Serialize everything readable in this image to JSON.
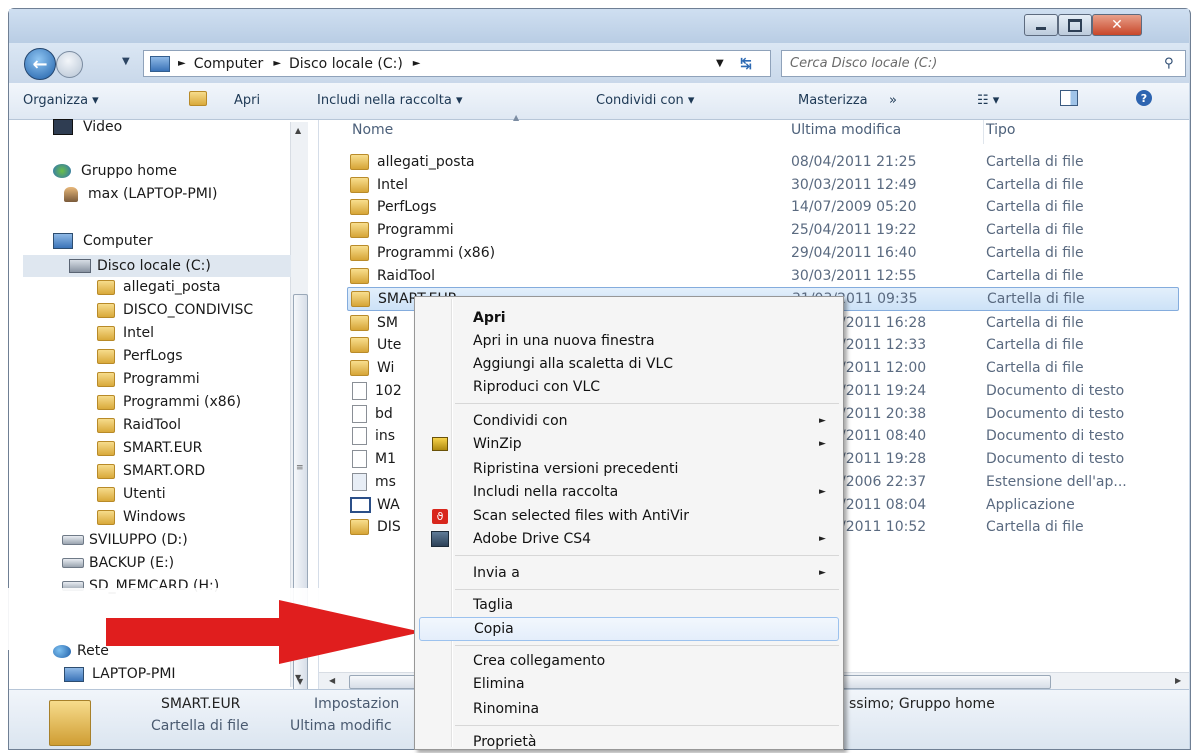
{
  "address": {
    "crumbs": [
      "Computer",
      "Disco locale (C:)"
    ],
    "search_placeholder": "Cerca Disco locale (C:)"
  },
  "toolbar": {
    "organize": "Organizza ▾",
    "open": "Apri",
    "include": "Includi nella raccolta ▾",
    "share": "Condividi con ▾",
    "burn": "Masterizza",
    "more": "»"
  },
  "nav": {
    "video": "Video",
    "homegroup": "Gruppo home",
    "homegroup_user": "max (LAPTOP-PMI)",
    "computer": "Computer",
    "local_disk": "Disco locale (C:)",
    "folders": [
      "allegati_posta",
      "DISCO_CONDIVISC",
      "Intel",
      "PerfLogs",
      "Programmi",
      "Programmi (x86)",
      "RaidTool",
      "SMART.EUR",
      "SMART.ORD",
      "Utenti",
      "Windows"
    ],
    "drives": [
      "SVILUPPO (D:)",
      "BACKUP (E:)",
      "SD_MEMCARD (H:)"
    ],
    "network": "Rete",
    "network_pc": "LAPTOP-PMI"
  },
  "columns": {
    "name": "Nome",
    "modified": "Ultima modifica",
    "type": "Tipo"
  },
  "files": [
    {
      "name": "allegati_posta",
      "date": "08/04/2011 21:25",
      "type": "Cartella di file"
    },
    {
      "name": "Intel",
      "date": "30/03/2011 12:49",
      "type": "Cartella di file"
    },
    {
      "name": "PerfLogs",
      "date": "14/07/2009 05:20",
      "type": "Cartella di file"
    },
    {
      "name": "Programmi",
      "date": "25/04/2011 19:22",
      "type": "Cartella di file"
    },
    {
      "name": "Programmi (x86)",
      "date": "29/04/2011 16:40",
      "type": "Cartella di file"
    },
    {
      "name": "RaidTool",
      "date": "30/03/2011 12:55",
      "type": "Cartella di file"
    },
    {
      "name": "SMART.EUR",
      "date": "31/03/2011 09:35",
      "type": "Cartella di file"
    },
    {
      "name": "SM",
      "date": "/2011 16:28",
      "type": "Cartella di file"
    },
    {
      "name": "Ute",
      "date": "/2011 12:33",
      "type": "Cartella di file"
    },
    {
      "name": "Wi",
      "date": "/2011 12:00",
      "type": "Cartella di file"
    },
    {
      "name": "102",
      "date": "/2011 19:24",
      "type": "Documento di testo"
    },
    {
      "name": "bd",
      "date": "/2011 20:38",
      "type": "Documento di testo"
    },
    {
      "name": "ins",
      "date": "/2011 08:40",
      "type": "Documento di testo"
    },
    {
      "name": "M1",
      "date": "/2011 19:28",
      "type": "Documento di testo"
    },
    {
      "name": "ms",
      "date": "/2006 22:37",
      "type": "Estensione dell'ap..."
    },
    {
      "name": "WA",
      "date": "/2011 08:04",
      "type": "Applicazione"
    },
    {
      "name": "DIS",
      "date": "/2011 10:52",
      "type": "Cartella di file"
    }
  ],
  "details": {
    "name": "SMART.EUR",
    "kind": "Cartella di file",
    "line1_mid": "Impostazion",
    "line2_mid": "Ultima modific",
    "line1_right": "ssimo; Gruppo home"
  },
  "context_menu": {
    "open": "Apri",
    "open_new_window": "Apri in una nuova finestra",
    "add_vlc_playlist": "Aggiungi alla scaletta di VLC",
    "play_vlc": "Riproduci con VLC",
    "share_with": "Condividi con",
    "winzip": "WinZip",
    "restore_versions": "Ripristina versioni precedenti",
    "include_library": "Includi nella raccolta",
    "antivir": "Scan selected files with AntiVir",
    "adobe_drive": "Adobe Drive CS4",
    "send_to": "Invia a",
    "cut": "Taglia",
    "copy": "Copia",
    "create_shortcut": "Crea collegamento",
    "delete": "Elimina",
    "rename": "Rinomina",
    "properties": "Proprietà"
  },
  "colors": {
    "accent_arrow": "#e01e1e",
    "selection": "#cde2f7",
    "chrome": "#c8d6e6"
  }
}
